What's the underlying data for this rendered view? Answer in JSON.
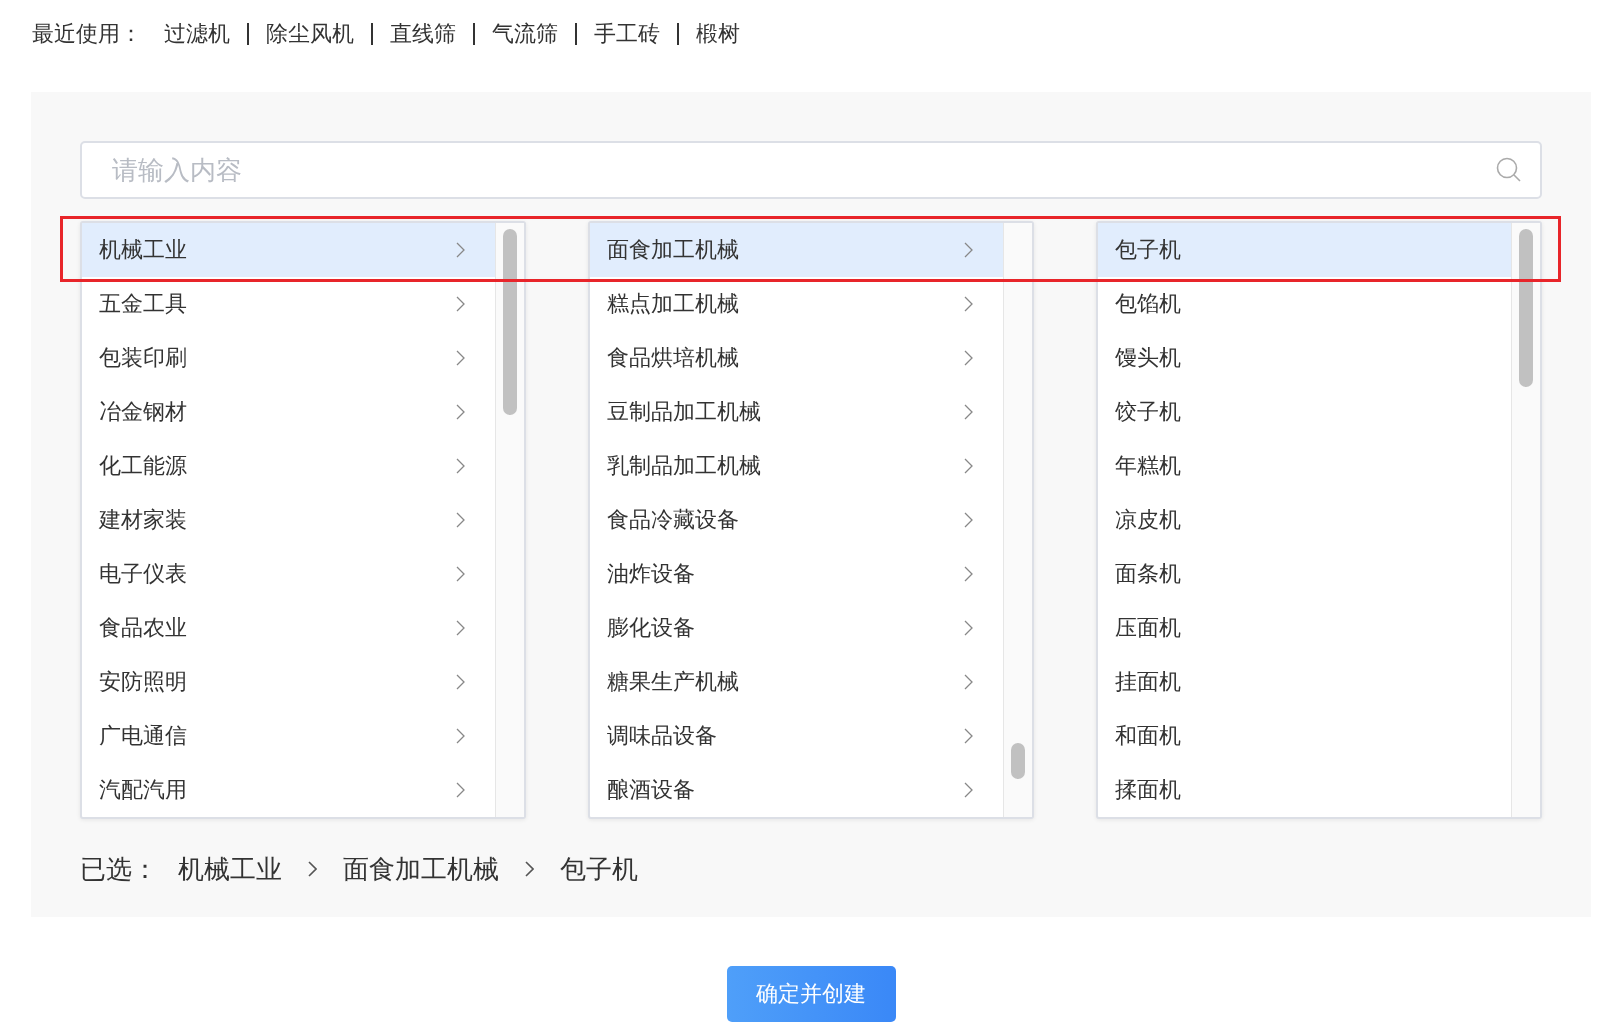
{
  "recent": {
    "label": "最近使用：",
    "items": [
      "过滤机",
      "除尘风机",
      "直线筛",
      "气流筛",
      "手工砖",
      "椴树"
    ]
  },
  "search": {
    "placeholder": "请输入内容"
  },
  "columns": [
    {
      "kind": "branch",
      "items": [
        {
          "label": "机械工业",
          "selected": true
        },
        {
          "label": "五金工具",
          "selected": false
        },
        {
          "label": "包装印刷",
          "selected": false
        },
        {
          "label": "冶金钢材",
          "selected": false
        },
        {
          "label": "化工能源",
          "selected": false
        },
        {
          "label": "建材家装",
          "selected": false
        },
        {
          "label": "电子仪表",
          "selected": false
        },
        {
          "label": "食品农业",
          "selected": false
        },
        {
          "label": "安防照明",
          "selected": false
        },
        {
          "label": "广电通信",
          "selected": false
        },
        {
          "label": "汽配汽用",
          "selected": false
        }
      ]
    },
    {
      "kind": "branch",
      "items": [
        {
          "label": "面食加工机械",
          "selected": true
        },
        {
          "label": "糕点加工机械",
          "selected": false
        },
        {
          "label": "食品烘培机械",
          "selected": false
        },
        {
          "label": "豆制品加工机械",
          "selected": false
        },
        {
          "label": "乳制品加工机械",
          "selected": false
        },
        {
          "label": "食品冷藏设备",
          "selected": false
        },
        {
          "label": "油炸设备",
          "selected": false
        },
        {
          "label": "膨化设备",
          "selected": false
        },
        {
          "label": "糖果生产机械",
          "selected": false
        },
        {
          "label": "调味品设备",
          "selected": false
        },
        {
          "label": "酿酒设备",
          "selected": false
        }
      ]
    },
    {
      "kind": "leaf",
      "items": [
        {
          "label": "包子机",
          "selected": true
        },
        {
          "label": "包馅机",
          "selected": false
        },
        {
          "label": "馒头机",
          "selected": false
        },
        {
          "label": "饺子机",
          "selected": false
        },
        {
          "label": "年糕机",
          "selected": false
        },
        {
          "label": "凉皮机",
          "selected": false
        },
        {
          "label": "面条机",
          "selected": false
        },
        {
          "label": "压面机",
          "selected": false
        },
        {
          "label": "挂面机",
          "selected": false
        },
        {
          "label": "和面机",
          "selected": false
        },
        {
          "label": "揉面机",
          "selected": false
        }
      ]
    }
  ],
  "selected_path": {
    "label": "已选：",
    "items": [
      "机械工业",
      "面食加工机械",
      "包子机"
    ]
  },
  "button": {
    "label": "确定并创建"
  }
}
